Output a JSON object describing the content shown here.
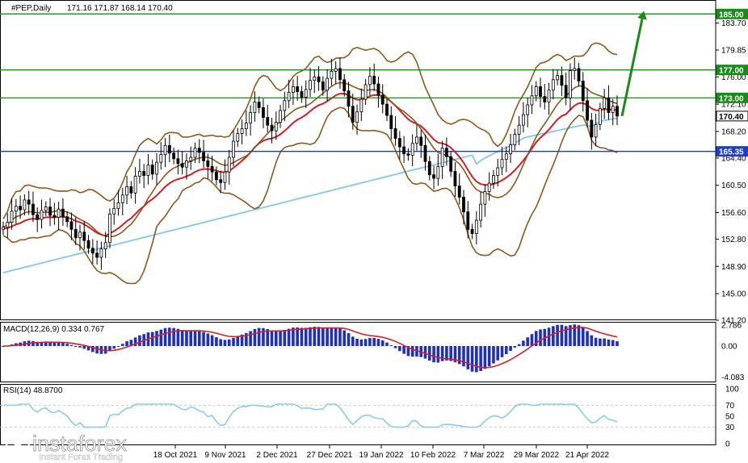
{
  "chart_data": [
    {
      "type": "candlestick",
      "symbol_label": "#PEP,Daily",
      "ohlc_label": "171.16 171.87 168.14 170.40",
      "y_ticks": [
        "183.70",
        "179.85",
        "176.00",
        "172.10",
        "168.20",
        "164.40",
        "160.50",
        "156.60",
        "152.80",
        "148.90",
        "145.00",
        "141.20"
      ],
      "ylim": [
        141.2,
        187.0
      ],
      "price_tags": [
        {
          "value": 185.0,
          "label": "185.00",
          "kind": "resistance",
          "color": "#1a8a1a"
        },
        {
          "value": 177.0,
          "label": "177.00",
          "kind": "resistance",
          "color": "#1a8a1a"
        },
        {
          "value": 173.0,
          "label": "173.00",
          "kind": "resistance",
          "color": "#1a8a1a"
        },
        {
          "value": 170.4,
          "label": "170.40",
          "kind": "current",
          "color": "#000000"
        },
        {
          "value": 165.35,
          "label": "165.35",
          "kind": "support",
          "color": "#1f3fbf"
        }
      ],
      "closes": [
        154.5,
        155.2,
        156.8,
        157.5,
        157.0,
        158.4,
        157.8,
        156.3,
        155.6,
        156.9,
        157.4,
        156.2,
        155.9,
        157.1,
        156.0,
        155.3,
        154.2,
        153.0,
        153.8,
        152.6,
        151.5,
        150.8,
        150.2,
        151.4,
        152.3,
        156.4,
        157.2,
        158.0,
        159.1,
        160.3,
        159.4,
        161.8,
        162.5,
        161.9,
        163.4,
        162.1,
        163.8,
        164.9,
        166.2,
        165.1,
        164.3,
        163.6,
        163.1,
        164.0,
        164.5,
        165.8,
        165.2,
        164.0,
        163.2,
        162.4,
        161.3,
        160.9,
        162.4,
        164.5,
        166.8,
        167.9,
        168.6,
        169.4,
        170.9,
        172.4,
        171.6,
        170.2,
        169.1,
        168.3,
        169.5,
        171.2,
        172.6,
        173.8,
        174.6,
        173.9,
        173.1,
        174.2,
        175.5,
        176.0,
        175.3,
        174.1,
        175.8,
        176.8,
        177.2,
        175.6,
        174.0,
        171.8,
        169.5,
        171.0,
        172.8,
        174.9,
        176.1,
        175.0,
        173.4,
        172.1,
        170.5,
        168.6,
        167.2,
        166.0,
        165.0,
        164.8,
        166.5,
        167.4,
        166.2,
        163.9,
        162.0,
        161.5,
        163.2,
        165.8,
        164.6,
        162.5,
        160.4,
        158.8,
        156.7,
        154.2,
        153.6,
        155.5,
        157.8,
        159.6,
        160.8,
        161.9,
        163.0,
        164.2,
        165.0,
        166.3,
        167.8,
        169.1,
        170.6,
        172.0,
        173.3,
        174.6,
        173.2,
        172.4,
        174.1,
        175.6,
        176.2,
        174.8,
        173.0,
        176.9,
        177.2,
        175.4,
        172.6,
        169.8,
        167.4,
        169.2,
        171.5,
        173.0,
        170.9,
        171.8,
        170.4
      ],
      "bollinger": {
        "period": 20,
        "deviations": 2
      },
      "moving_averages": [
        {
          "name": "ma-fast",
          "period": 50,
          "color": "#d0202a"
        },
        {
          "name": "ma-slow",
          "period": 200,
          "color": "#8fcbe3"
        }
      ],
      "forecast_arrow": {
        "from_value": 170.4,
        "to_value": 184.3,
        "color": "#1a8a1a"
      }
    },
    {
      "type": "bar",
      "label": "MACD(12,26,9) 0.334 0.767",
      "y_ticks": [
        "2.786",
        "0.00",
        "-4.083"
      ],
      "ylim": [
        -4.8,
        3.2
      ],
      "signal_color": "#d0202a",
      "histogram_color": "#1f2fbf"
    },
    {
      "type": "line",
      "label": "RSI(14) 48.8700",
      "y_ticks": [
        "100",
        "70",
        "50",
        "30",
        "0"
      ],
      "ylim": [
        0,
        100
      ],
      "color": "#8fcbe3"
    }
  ],
  "x_labels": [
    "18 Oct 2021",
    "9 Nov 2021",
    "2 Dec 2021",
    "27 Dec 2021",
    "19 Jan 2022",
    "10 Feb 2022",
    "7 Mar 2022",
    "29 Mar 2022",
    "21 Apr 2022"
  ],
  "watermark": {
    "brand": "instaforex",
    "tagline": "Instant Forex Trading"
  }
}
